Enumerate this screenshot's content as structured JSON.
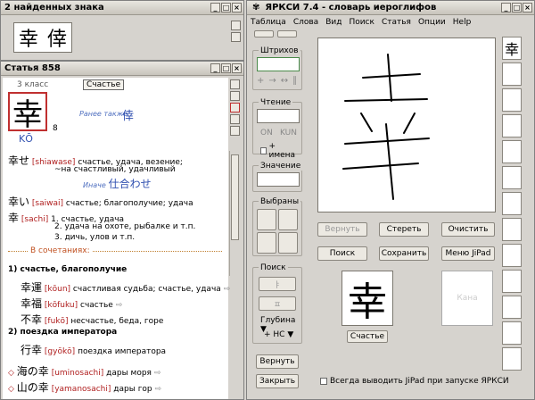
{
  "found_panel": {
    "title": "2 найденных знака",
    "chars": [
      "幸",
      "倖"
    ]
  },
  "article": {
    "title": "Статья 858",
    "grade": "3 класс",
    "tag": "Счастье",
    "kanji": "幸",
    "strokes": "8",
    "onyomi": "KŌ",
    "see_also_label": "Ранее также",
    "see_also_char": "倖",
    "entries": [
      {
        "word": "幸せ",
        "reading": "[shiawase]",
        "meaning": "счастье, удача, везение;"
      },
      {
        "word": "",
        "reading": "",
        "meaning": "~на счастливый, удачливый"
      },
      {
        "word": "",
        "reading": "Иначе",
        "meaning": "仕合わせ"
      },
      {
        "word": "幸い",
        "reading": "[saiwai]",
        "meaning": "счастье; благополучие; удача"
      },
      {
        "word": "幸",
        "reading": "[sachi]",
        "meaning": "1. счастье, удача"
      }
    ],
    "sachi_more": [
      "2. удача на охоте, рыбалке и т.п.",
      "3. дичь, улов и т.п."
    ],
    "combos_label": "В сочетаниях:",
    "sec1": "1) счастье, благополучие",
    "sec1_items": [
      {
        "word": "幸運",
        "reading": "[kōun]",
        "meaning": "счастливая судьба; счастье, удача"
      },
      {
        "word": "幸福",
        "reading": "[kōfuku]",
        "meaning": "счастье"
      },
      {
        "word": "不幸",
        "reading": "[fukō]",
        "meaning": "несчастье, беда, горе"
      }
    ],
    "sec2": "2) поездка императора",
    "sec2_items": [
      {
        "word": "行幸",
        "reading": "[gyōkō]",
        "meaning": "поездка императора"
      }
    ],
    "extra": [
      {
        "word": "海の幸",
        "reading": "[uminosachi]",
        "meaning": "дары моря"
      },
      {
        "word": "山の幸",
        "reading": "[yamanosachi]",
        "meaning": "дары гор"
      }
    ]
  },
  "main": {
    "title": "ЯРКСИ 7.4  -  словарь иероглифов",
    "menu": [
      "Таблица",
      "Слова",
      "Вид",
      "Поиск",
      "Статья",
      "Опции",
      "Help"
    ],
    "strokes_label": "Штрихов",
    "reading_label": "Чтение",
    "on_label": "ON",
    "kun_label": "KUN",
    "names_label": "+ имена",
    "meaning_label": "Значение",
    "selected_label": "Выбраны",
    "search_label": "Поиск",
    "depth_label": "Глубина",
    "nc_label": "+ НС",
    "back_btn": "Вернуть",
    "close_btn": "Закрыть",
    "draw_btns": [
      "Вернуть",
      "Стереть",
      "Очистить"
    ],
    "action_btns": [
      "Поиск",
      "Сохранить",
      "Меню JiPad"
    ],
    "result_kanji": "幸",
    "result_tag": "Счастье",
    "kana_placeholder": "Кана",
    "checkbox_label": "Всегда выводить JiPad при запуске ЯРКСИ",
    "side_first": "幸"
  }
}
